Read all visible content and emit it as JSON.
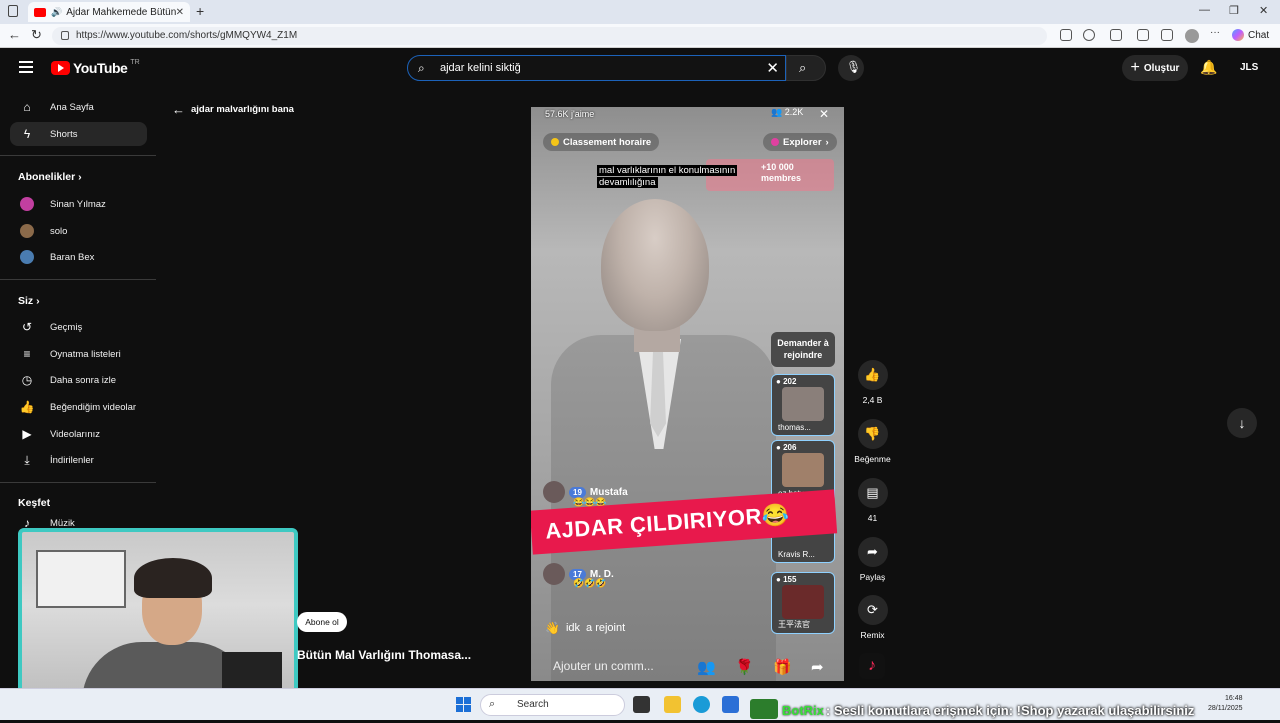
{
  "browser": {
    "tab_title": "Ajdar Mahkemede Bütün Ma",
    "url": "https://www.youtube.com/shorts/gMMQYW4_Z1M",
    "chat_label": "Chat"
  },
  "header": {
    "logo_text": "YouTube",
    "logo_region": "TR",
    "search_value": "ajdar kelini siktiğ",
    "create_label": "Oluştur",
    "account_initials": "JLS"
  },
  "sidebar": {
    "home": "Ana Sayfa",
    "shorts": "Shorts",
    "subscriptions_heading": "Abonelikler",
    "subscriptions": [
      "Sinan Yılmaz",
      "solo",
      "Baran Bex"
    ],
    "you_heading": "Siz",
    "you_items": [
      "Geçmiş",
      "Oynatma listeleri",
      "Daha sonra izle",
      "Beğendiğim videolar",
      "Videolarınız",
      "İndirilenler"
    ],
    "explore_heading": "Keşfet",
    "music": "Müzik"
  },
  "back_link": "ajdar malvarlığını bana",
  "video": {
    "likes_text": "57.6K j'aime",
    "viewer_count": "2.2K",
    "ranking_label": "Classement horaire",
    "explore_label": "Explorer",
    "caption_line1": "mal varlıklarının el konulmasının",
    "caption_line2": "devamlılığına",
    "members_text": "10 000 membres",
    "members_prefix": "+",
    "demander": "Demander à rejoindre",
    "guests": [
      {
        "count": "202",
        "name": "thomas..."
      },
      {
        "count": "206",
        "name": "ez hatum..."
      },
      {
        "count": "",
        "name": "Kravis R..."
      },
      {
        "count": "155",
        "name": "王平法官"
      }
    ],
    "comment1_badge": "19",
    "comment1_name": "Mustafa",
    "comment1_emoji": "😂😂😂",
    "comment2_badge": "17",
    "comment2_name": "M. D.",
    "comment2_emoji": "🤣🤣🤣",
    "banner": "AJDAR ÇILDIRIYOR😂",
    "join_text_pre": "idk",
    "join_text": "a rejoint",
    "comment_placeholder": "Ajouter un comm..."
  },
  "actions": {
    "like_count": "2,4 B",
    "dislike_label": "Beğenme",
    "comment_count": "41",
    "share_label": "Paylaş",
    "remix_label": "Remix"
  },
  "channel": {
    "subscribe_label": "Abone ol",
    "video_title": "Bütün Mal Varlığını Thomasa..."
  },
  "taskbar": {
    "search_label": "Search",
    "bot_name": "BotRix",
    "bot_message": ": Sesli komutlara erişmek için: !Shop yazarak ulaşabilirsiniz",
    "time": "16:48",
    "date": "28/11/2025"
  },
  "colors": {
    "yt_red": "#ff0000",
    "accent_blue": "#1c62b9",
    "banner_pink": "#e8194c",
    "webcam_border": "#3ec9c2",
    "bot_green": "#38e038"
  }
}
